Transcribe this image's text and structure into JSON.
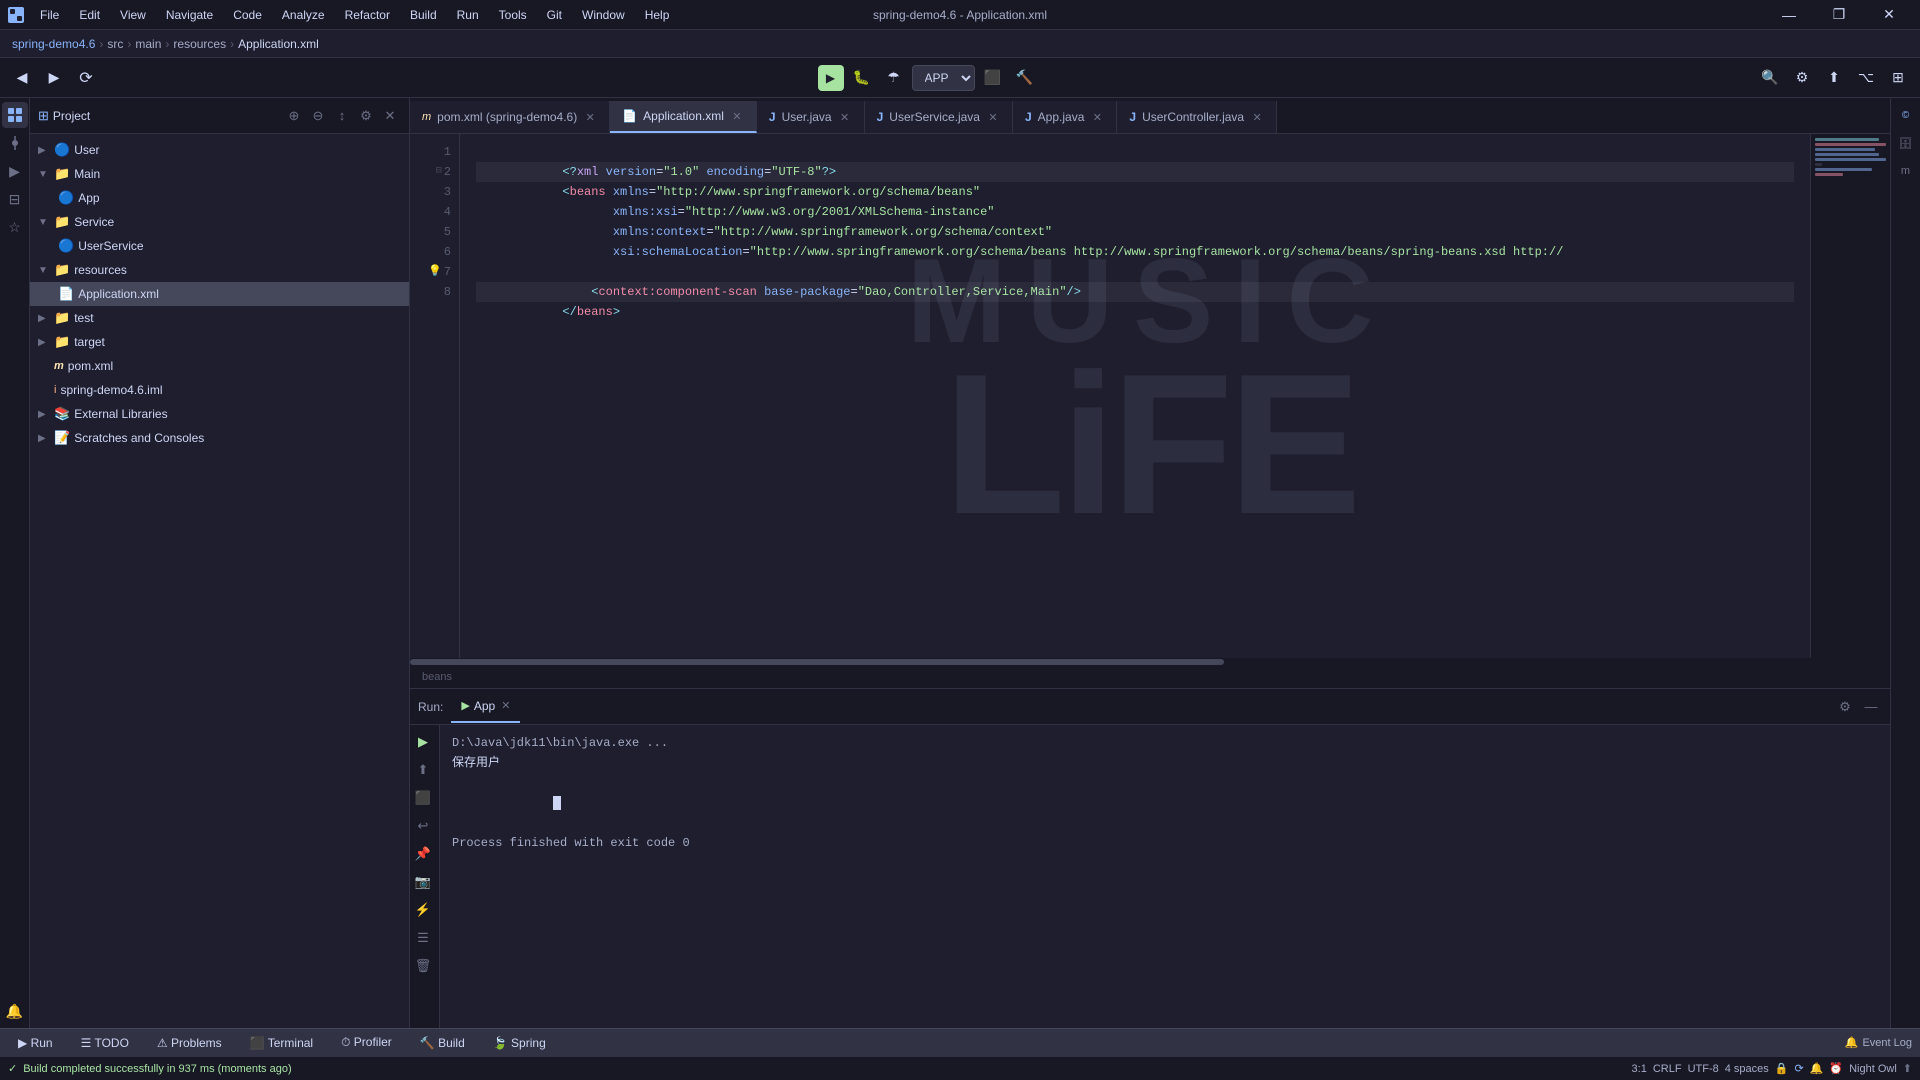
{
  "window": {
    "title": "spring-demo4.6 - Application.xml",
    "controls": [
      "—",
      "❐",
      "✕"
    ]
  },
  "menu": {
    "items": [
      "File",
      "Edit",
      "View",
      "Navigate",
      "Code",
      "Analyze",
      "Refactor",
      "Build",
      "Run",
      "Tools",
      "Git",
      "Window",
      "Help"
    ]
  },
  "breadcrumb": {
    "parts": [
      "spring-demo4.6",
      "src",
      "main",
      "resources",
      "Application.xml"
    ]
  },
  "toolbar": {
    "run_config": "APP",
    "run_label": "▶",
    "buttons": [
      "◀",
      "▶",
      "⟳",
      "⚙",
      "⬛",
      "⬆",
      "▸"
    ]
  },
  "tabs": [
    {
      "id": "pom",
      "label": "pom.xml (spring-demo4.6)",
      "icon": "m",
      "active": false
    },
    {
      "id": "application",
      "label": "Application.xml",
      "icon": "xml",
      "active": true
    },
    {
      "id": "user",
      "label": "User.java",
      "icon": "j",
      "active": false
    },
    {
      "id": "userservice",
      "label": "UserService.java",
      "icon": "j",
      "active": false
    },
    {
      "id": "app",
      "label": "App.java",
      "icon": "j",
      "active": false
    },
    {
      "id": "usercontroller",
      "label": "UserController.java",
      "icon": "j",
      "active": false
    }
  ],
  "project_panel": {
    "title": "Project",
    "tree": [
      {
        "level": 0,
        "type": "folder",
        "name": "User",
        "icon": "🔵",
        "expanded": false
      },
      {
        "level": 0,
        "type": "folder",
        "name": "Main",
        "icon": "📁",
        "expanded": true
      },
      {
        "level": 1,
        "type": "file",
        "name": "App",
        "icon": "🔵"
      },
      {
        "level": 0,
        "type": "folder",
        "name": "Service",
        "icon": "📁",
        "expanded": true
      },
      {
        "level": 1,
        "type": "file",
        "name": "UserService",
        "icon": "🔵"
      },
      {
        "level": 0,
        "type": "folder",
        "name": "resources",
        "icon": "📁",
        "expanded": true
      },
      {
        "level": 1,
        "type": "file",
        "name": "Application.xml",
        "icon": "🟣",
        "selected": true
      },
      {
        "level": 0,
        "type": "folder",
        "name": "test",
        "icon": "📁",
        "expanded": false
      },
      {
        "level": 0,
        "type": "folder",
        "name": "target",
        "icon": "📁",
        "expanded": false
      },
      {
        "level": 0,
        "type": "file",
        "name": "pom.xml",
        "icon": "m"
      },
      {
        "level": 0,
        "type": "file",
        "name": "spring-demo4.6.iml",
        "icon": "i"
      },
      {
        "level": 0,
        "type": "folder",
        "name": "External Libraries",
        "icon": "📚",
        "expanded": false
      },
      {
        "level": 0,
        "type": "folder",
        "name": "Scratches and Consoles",
        "icon": "📝",
        "expanded": false
      }
    ]
  },
  "code": {
    "lines": [
      {
        "num": 1,
        "content": "<?xml version=\"1.0\" encoding=\"UTF-8\"?>"
      },
      {
        "num": 2,
        "content": "<beans xmlns=\"http://www.springframework.org/schema/beans\""
      },
      {
        "num": 3,
        "content": "       xmlns:xsi=\"http://www.w3.org/2001/XMLSchema-instance\""
      },
      {
        "num": 4,
        "content": "       xmlns:context=\"http://www.springframework.org/schema/context\""
      },
      {
        "num": 5,
        "content": "       xsi:schemaLocation=\"http://www.springframework.org/schema/beans http://www.springframework.org/schema/beans/spring-beans.xsd http://"
      },
      {
        "num": 6,
        "content": ""
      },
      {
        "num": 7,
        "content": "    <context:component-scan base-package=\"Dao,Controller,Service,Main\"/>"
      },
      {
        "num": 8,
        "content": "</beans>"
      }
    ],
    "status_hint": "beans"
  },
  "run_panel": {
    "label": "Run:",
    "tab": "App",
    "output": [
      "D:\\Java\\jdk11\\bin\\java.exe ...",
      "保存用户",
      "",
      "Process finished with exit code 0"
    ]
  },
  "bottom_tabs": [
    {
      "id": "run",
      "label": "▶  Run"
    },
    {
      "id": "todo",
      "label": "☰  TODO"
    },
    {
      "id": "problems",
      "label": "⚠  Problems"
    },
    {
      "id": "terminal",
      "label": "⬛  Terminal"
    },
    {
      "id": "profiler",
      "label": "⏱  Profiler"
    },
    {
      "id": "build",
      "label": "🔨  Build"
    },
    {
      "id": "spring",
      "label": "🍃  Spring"
    }
  ],
  "status_bar": {
    "build_message": "Build completed successfully in 937 ms (moments ago)",
    "position": "3:1",
    "line_ending": "CRLF",
    "encoding": "UTF-8",
    "indent": "4 spaces",
    "theme": "Night Owl",
    "event_log": "Event Log"
  }
}
